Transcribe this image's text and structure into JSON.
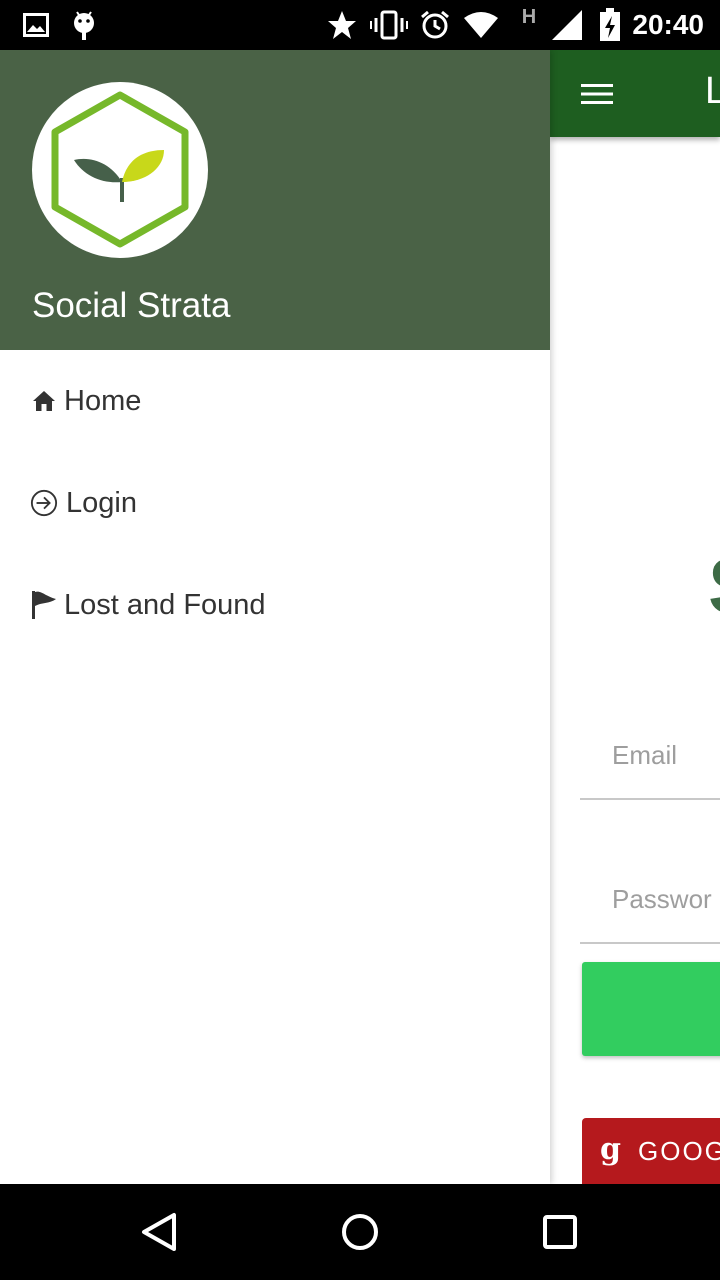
{
  "status_bar": {
    "time": "20:40",
    "network_type": "H",
    "icons": [
      "image-icon",
      "android-icon",
      "star-icon",
      "vibrate-icon",
      "alarm-icon",
      "wifi-icon",
      "signal-icon",
      "battery-charging-icon"
    ]
  },
  "drawer": {
    "app_name": "Social Strata",
    "items": [
      {
        "label": "Home",
        "icon": "home-icon"
      },
      {
        "label": "Login",
        "icon": "login-icon"
      },
      {
        "label": "Lost and Found",
        "icon": "flag-icon"
      }
    ]
  },
  "app": {
    "toolbar_title": "L",
    "heading": "S",
    "email_placeholder": "Email",
    "password_placeholder": "Passwor",
    "google_button_label": "GOOG",
    "google_glyph": "g"
  },
  "colors": {
    "drawer_header": "#4a6246",
    "toolbar": "#1e5e20",
    "login_button": "#32cd5f",
    "google_button": "#b5191d",
    "logo_hexagon": "#76b82a",
    "logo_leaf_dark": "#46604a",
    "logo_leaf_light": "#c8d81a"
  }
}
